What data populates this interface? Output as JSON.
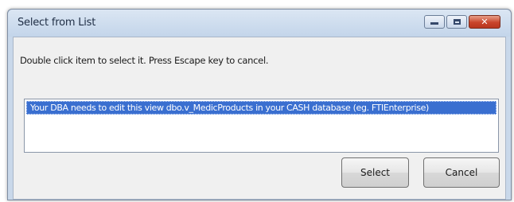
{
  "window": {
    "title": "Select from List",
    "controls": {
      "minimize_icon": "minimize-icon",
      "maximize_icon": "maximize-icon",
      "close_icon": "close-icon",
      "close_glyph": "✕"
    }
  },
  "instruction": "Double click item to select it. Press Escape key to cancel.",
  "list": {
    "items": [
      {
        "label": "Your DBA needs to edit this view dbo.v_MedicProducts in your CASH database (eg. FTIEnterprise)",
        "selected": true
      }
    ]
  },
  "buttons": {
    "select_label": "Select",
    "cancel_label": "Cancel"
  },
  "colors": {
    "selection": "#3a6fd0",
    "titlebar": "#c9d8ea",
    "close_button": "#c9442a"
  }
}
